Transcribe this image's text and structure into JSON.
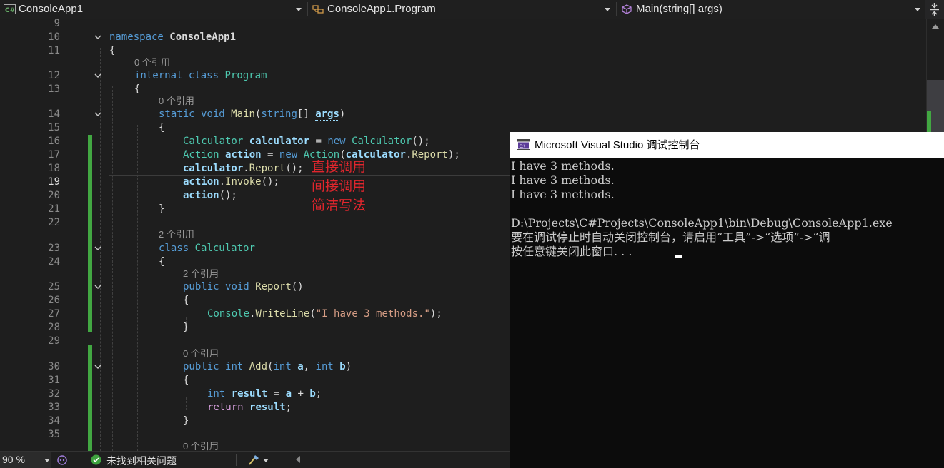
{
  "navbar": {
    "project": "ConsoleApp1",
    "class": "ConsoleApp1.Program",
    "member": "Main(string[] args)"
  },
  "editor": {
    "line_numbers": [
      "9",
      "10",
      "11",
      "12",
      "13",
      "14",
      "15",
      "16",
      "17",
      "18",
      "19",
      "20",
      "21",
      "22",
      "23",
      "24",
      "25",
      "26",
      "27",
      "28",
      "29",
      "30",
      "31",
      "32",
      "33",
      "34",
      "35"
    ],
    "current_line": "19",
    "code_lens": {
      "program": "0 个引用",
      "main": "0 个引用",
      "calculator": "2 个引用",
      "report": "2 个引用",
      "add": "0 个引用",
      "next": "0 个引用"
    },
    "tokens": {
      "namespace": "namespace",
      "console_app1": "ConsoleApp1",
      "internal": "internal",
      "class": "class",
      "program": "Program",
      "static": "static",
      "void": "void",
      "main": "Main",
      "string": "string",
      "args": "args",
      "calculator_type": "Calculator",
      "calculator_var": "calculator",
      "new": "new",
      "action_type": "Action",
      "action_var": "action",
      "report": "Report",
      "invoke": "Invoke",
      "public": "public",
      "console": "Console",
      "writeline": "WriteLine",
      "string_literal": "\"I have 3 methods.\"",
      "int": "int",
      "add": "Add",
      "a": "a",
      "b": "b",
      "result": "result",
      "return": "return"
    },
    "annotations": [
      "直接调用",
      "间接调用",
      "简洁写法"
    ]
  },
  "statusbar": {
    "zoom": "90 %",
    "issues": "未找到相关问题"
  },
  "console": {
    "title": "Microsoft Visual Studio 调试控制台",
    "lines": [
      "I have 3 methods.",
      "I have 3 methods.",
      "I have 3 methods.",
      "",
      "D:\\Projects\\C#Projects\\ConsoleApp1\\bin\\Debug\\ConsoleApp1.exe",
      "要在调试停止时自动关闭控制台，请启用“工具”->“选项”->“调",
      "按任意键关闭此窗口. . ."
    ]
  },
  "colors": {
    "editor_bg": "#1e1e1e",
    "keyword": "#569cd6",
    "type": "#4ec9b0",
    "method": "#dcdcaa",
    "string": "#d69d85",
    "identifier": "#9cdcfe",
    "annotation": "#e0262d",
    "change_bar": "#42a742",
    "console_bg": "#0c0c0c"
  }
}
